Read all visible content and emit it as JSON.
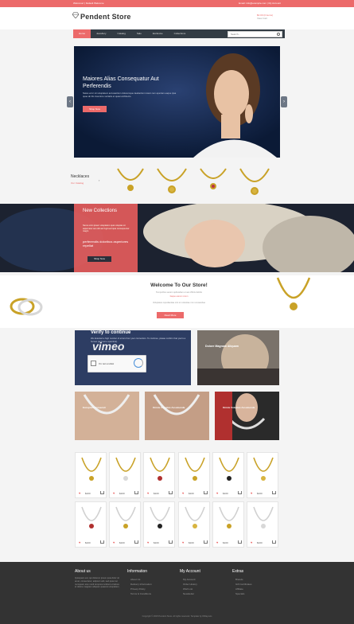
{
  "topbar": {
    "left": "Welcome! | Default Welcome",
    "right": "Email: info@example.com   |   My Account"
  },
  "header": {
    "logo": "Pendent Store",
    "cart_line1": "$0.00 (0 items)",
    "cart_line2": "View Cart"
  },
  "nav": {
    "items": [
      "Home",
      "Jewellery",
      "Catalog",
      "Sale",
      "Exclusive",
      "Collections"
    ],
    "search_placeholder": "Search..."
  },
  "hero": {
    "title": "Maiores Alias Consequatur Aut Perferendis",
    "text": "Natus error sit voluptatem accusantium doloremque laudantium totam rem aperiam eaque ipsa quae ab illo inventore veritatis et quasi architecto.",
    "button": "Shop Now"
  },
  "necklaces": {
    "title": "Necklaces",
    "subtitle": "Our Catalog"
  },
  "collections": {
    "title": "New Collections",
    "text": "Nemo enim ipsam voluptatem quia voluptas sit aspernatur aut odit aut fugit sed quia consequuntur magni.",
    "subtitle": "perferendis doloribus asperiores repellat",
    "button": "Shop Now"
  },
  "welcome": {
    "title": "Welcome To Our Store!",
    "line1": "Temporibus autem quibusdam et aut officiis debitis",
    "line2": "Itaque earum rerum",
    "line3": "Voluptates repudiandae sint et molestiae non recusandae",
    "button": "Read More"
  },
  "captcha": {
    "heading": "Verify to continue",
    "text": "We detected a high number of errors from your connection. To continue, please confirm that you're a human (and not a spambot).",
    "checkbox": "I'm not a robot",
    "brand": "vimeo"
  },
  "tiles": {
    "t2": "Dolore Magnam Aliquam",
    "t3": "Excepturi Occaecati",
    "t4": "Omnis Voluptas Assumenda",
    "t5": "Omnis Voluptas Assumenda"
  },
  "products": {
    "price": "$100"
  },
  "footer": {
    "about_title": "About us",
    "about_text": "Quisquam est, qui dolorem ipsum quia dolor sit amet, consectetur, adipisci velit, sed quia non numquam eius modi tempora incidunt ut labore et dolore magnam aliquam quaerat voluptatem.",
    "info_title": "Information",
    "info_links": [
      "About Us",
      "Delivery Information",
      "Privacy Policy",
      "Terms & Conditions"
    ],
    "account_title": "My Account",
    "account_links": [
      "My Account",
      "Order History",
      "Wish List",
      "Newsletter"
    ],
    "extras_title": "Extras",
    "extras_links": [
      "Brands",
      "Gift Certificates",
      "Affiliate",
      "Specials"
    ],
    "copyright": "Copyright © 2015 Pendent Store. All rights reserved. Template by W3layouts"
  },
  "colors": {
    "accent": "#ec6a6a",
    "nav": "#333c44",
    "footer": "#333333"
  }
}
